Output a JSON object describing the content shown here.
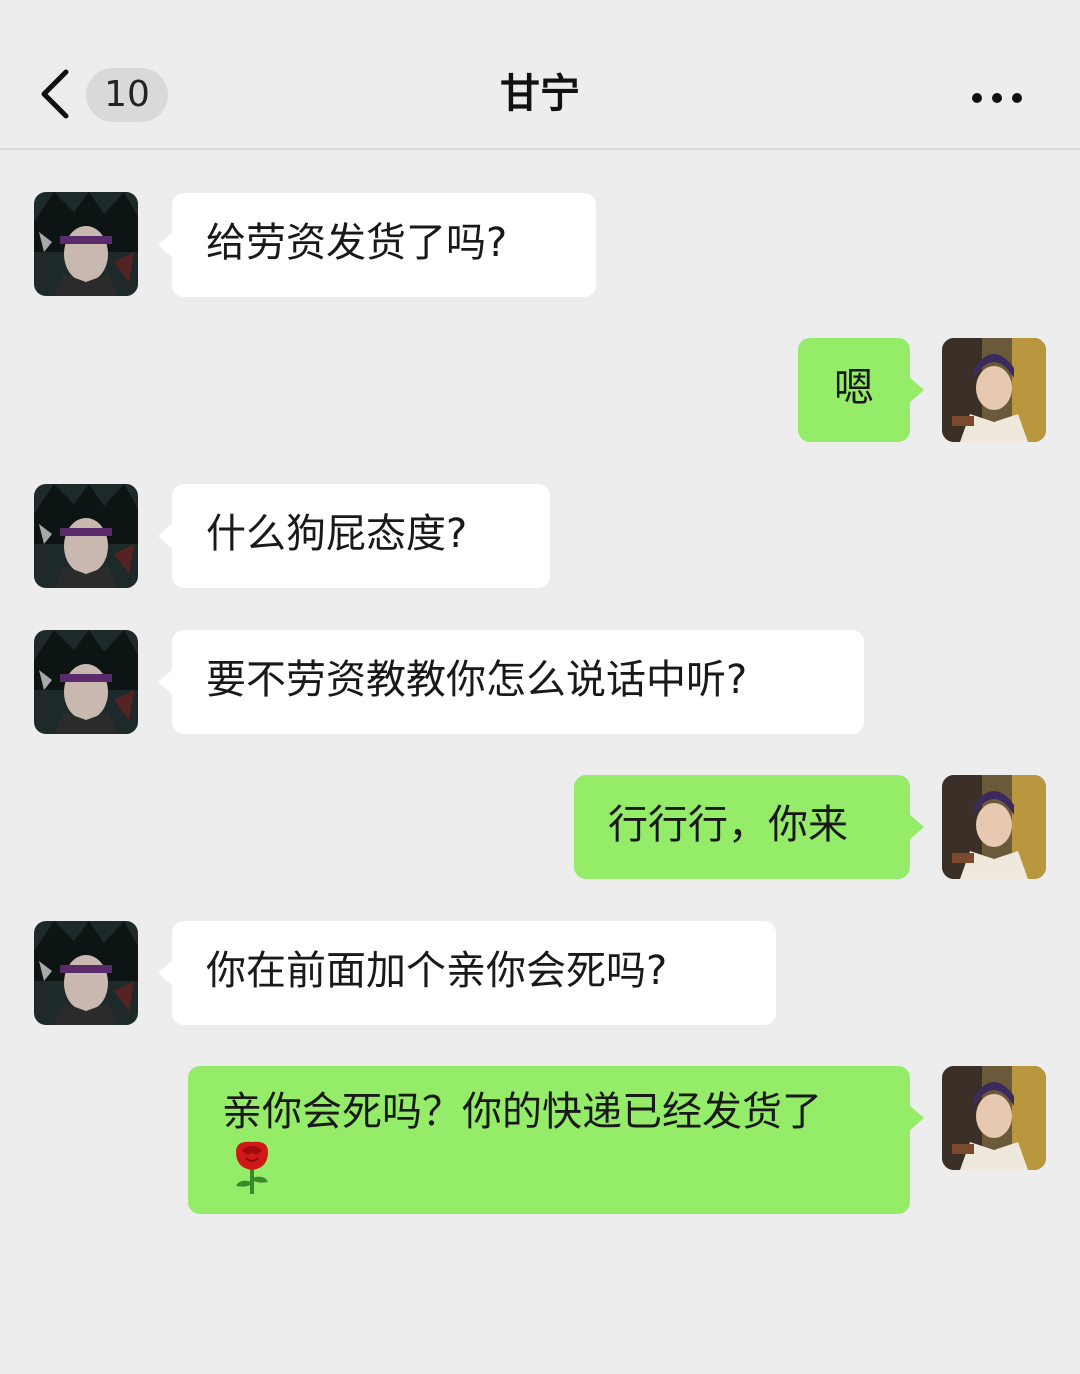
{
  "nav": {
    "unread_count": "10",
    "title": "甘宁",
    "back_icon": "chevron-left-icon",
    "more_icon": "more-dots-icon"
  },
  "colors": {
    "background": "#ededed",
    "incoming_bubble": "#ffffff",
    "outgoing_bubble": "#95ec69"
  },
  "messages": [
    {
      "side": "left",
      "text": "给劳资发货了吗?"
    },
    {
      "side": "right",
      "text": "嗯"
    },
    {
      "side": "left",
      "text": "什么狗屁态度?"
    },
    {
      "side": "left",
      "text": "要不劳资教教你怎么说话中听?"
    },
    {
      "side": "right",
      "text": "行行行，你来"
    },
    {
      "side": "left",
      "text": "你在前面加个亲你会死吗?"
    },
    {
      "side": "right",
      "text": "亲你会死吗？你的快递已经发货了",
      "emoji": "rose-icon"
    }
  ]
}
